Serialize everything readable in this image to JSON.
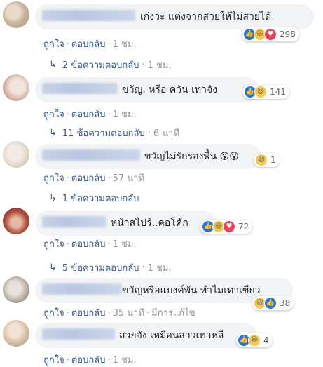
{
  "labels": {
    "like": "ถูกใจ",
    "reply": "ตอบกลับ",
    "dot": "·",
    "edited": "มีการแก้ไข"
  },
  "comments": [
    {
      "text": "เก่งวะ แต่งจากสวยให้ไม่สวยได้",
      "time": "1 ชม.",
      "reactions": [
        "like",
        "haha",
        "love"
      ],
      "reaction_count": "298",
      "replies": "2 ข้อความตอบกลับ",
      "replies_time": "1 ชม."
    },
    {
      "text": "ขวัญ. หรือ ควัน เทาจัง",
      "time": "1 ชม.",
      "reactions": [
        "like",
        "haha"
      ],
      "reaction_count": "141",
      "replies": "11 ข้อความตอบกลับ",
      "replies_time": "6 นาที"
    },
    {
      "text": "ขวัญไม่รักรองพื้น",
      "emoji": "😮😮",
      "time": "57 นาที",
      "reactions": [
        "haha"
      ],
      "reaction_count": "1",
      "replies": "1 ข้อความตอบกลับ",
      "replies_time": ""
    },
    {
      "text": "หน้าสไปร์..คอโค้ก",
      "time": "1 ชม.",
      "reactions": [
        "like",
        "haha",
        "love"
      ],
      "reaction_count": "72",
      "replies": "5 ข้อความตอบกลับ",
      "replies_time": "1 ชม."
    },
    {
      "text": "ขวัญหรือแบงค์พัน ทำไมเทาเขียว",
      "time": "35 นาที",
      "edited": true,
      "reactions": [
        "haha",
        "like"
      ],
      "reaction_count": "38"
    },
    {
      "text": "สวยจัง เหมือนสาวเทาหลี",
      "time": "1 ชม.",
      "reactions": [
        "like",
        "haha"
      ],
      "reaction_count": "4"
    }
  ],
  "colors": {
    "bubble": "#f2f3f5",
    "link": "#385898",
    "muted": "#90949c",
    "like": "#1877f2",
    "haha": "#f7c84a",
    "love": "#f33e58"
  },
  "icons": {
    "reply_arrow": "reply-arrow-icon",
    "like": "like-reaction-icon",
    "haha": "haha-reaction-icon",
    "love": "love-reaction-icon"
  }
}
